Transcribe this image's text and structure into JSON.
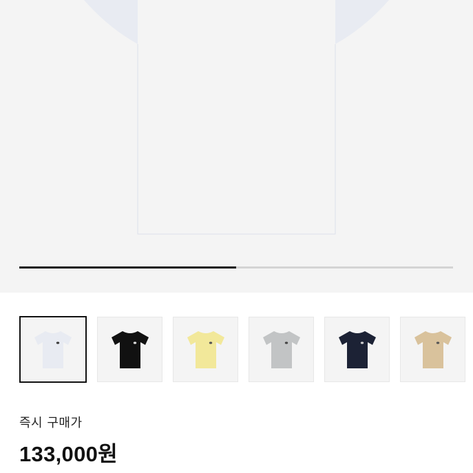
{
  "product": {
    "gallery": {
      "progress_fraction": 0.5,
      "main_color": "#e8ebf2"
    },
    "colors": [
      {
        "name": "white-tee",
        "fill": "#e8ebf2",
        "logo": "#3a3a3a",
        "selected": true
      },
      {
        "name": "black-tee",
        "fill": "#111111",
        "logo": "#e0e0e0",
        "selected": false
      },
      {
        "name": "yellow-tee",
        "fill": "#f2e89a",
        "logo": "#555555",
        "selected": false
      },
      {
        "name": "grey-tee",
        "fill": "#c2c4c5",
        "logo": "#444444",
        "selected": false
      },
      {
        "name": "navy-tee",
        "fill": "#1c2235",
        "logo": "#d0d0d0",
        "selected": false
      },
      {
        "name": "beige-tee",
        "fill": "#d9c29c",
        "logo": "#555555",
        "selected": false
      }
    ],
    "buy_now_label": "즉시 구매가",
    "price": "133,000원"
  }
}
